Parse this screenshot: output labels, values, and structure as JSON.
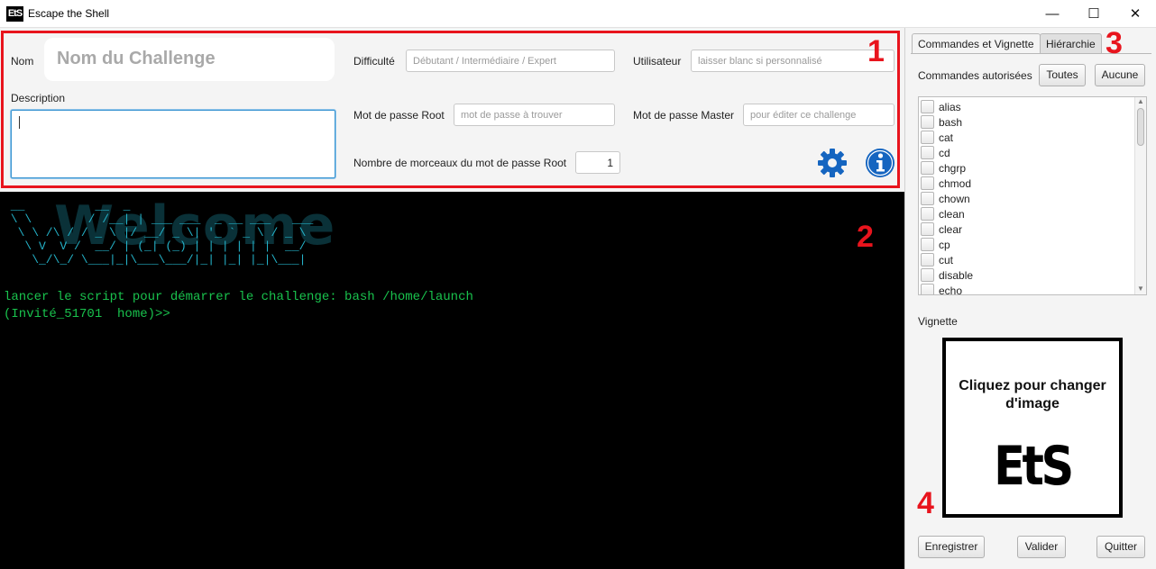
{
  "window": {
    "logo": "EtS",
    "title": "Escape the Shell",
    "minimize": "—",
    "maximize": "☐",
    "close": "✕"
  },
  "form": {
    "name_label": "Nom",
    "name_placeholder": "Nom du Challenge",
    "description_label": "Description",
    "difficulty_label": "Difficulté",
    "difficulty_placeholder": "Débutant / Intermédiaire / Expert",
    "user_label": "Utilisateur",
    "user_placeholder": "laisser blanc si personnalisé",
    "root_pw_label": "Mot de passe Root",
    "root_pw_placeholder": "mot de passe à trouver",
    "master_pw_label": "Mot de passe Master",
    "master_pw_placeholder": "pour éditer ce challenge",
    "pieces_label": "Nombre de morceaux du mot de passe Root",
    "pieces_value": "1"
  },
  "annotations": {
    "n1": "1",
    "n2": "2",
    "n3": "3",
    "n4": "4",
    "color": "#e8141d"
  },
  "terminal": {
    "ascii_art": " __          __  _\n \\ \\        / /__| | ___ ___  _ __ ___   ___\n  \\ \\ /\\ / / _ \\ |/ __/ _ \\| '_ ` _ \\ / _ \\\n   \\ V  V /  __/ | (_| (_) | | | | | |  __/\n    \\_/\\_/ \\___|_|\\___\\___/|_| |_| |_|\\___|",
    "banner_word": "Welcome",
    "line1": "lancer le script pour démarrer le challenge: bash /home/launch",
    "prompt": "(Invité_51701  home)>>",
    "text_color": "#19c24d",
    "ascii_color": "#24b2c8"
  },
  "sidebar": {
    "tabs": [
      {
        "label": "Commandes et Vignette",
        "active": true
      },
      {
        "label": "Hiérarchie",
        "active": false
      }
    ],
    "commands_label": "Commandes autorisées",
    "all_button": "Toutes",
    "none_button": "Aucune",
    "commands": [
      "alias",
      "bash",
      "cat",
      "cd",
      "chgrp",
      "chmod",
      "chown",
      "clean",
      "clear",
      "cp",
      "cut",
      "disable",
      "echo"
    ],
    "vignette_label": "Vignette",
    "vignette_text": "Cliquez pour changer d'image",
    "vignette_logo": "EtS",
    "save_button": "Enregistrer",
    "validate_button": "Valider",
    "quit_button": "Quitter"
  }
}
